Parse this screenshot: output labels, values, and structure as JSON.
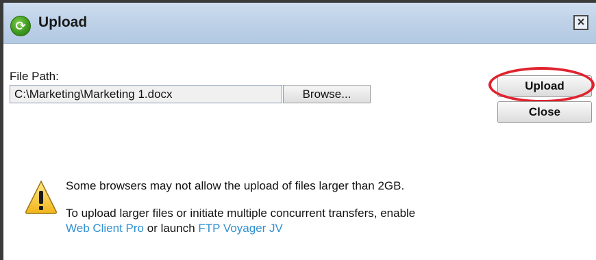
{
  "window": {
    "title": "Upload",
    "close_icon": "close-icon"
  },
  "form": {
    "file_path_label": "File Path:",
    "file_path_value": "C:\\Marketing\\Marketing 1.docx",
    "browse_label": "Browse..."
  },
  "actions": {
    "upload_label": "Upload",
    "close_label": "Close",
    "highlight_color": "#e0232e"
  },
  "notice": {
    "line1": "Some browsers may not allow the upload of files larger than 2GB.",
    "line2": "To upload larger files or initiate multiple concurrent transfers, enable",
    "link1": "Web Client Pro",
    "connector": " or launch ",
    "link2": "FTP Voyager JV",
    "link_color": "#2f8fd0",
    "icon": "warning-icon"
  }
}
